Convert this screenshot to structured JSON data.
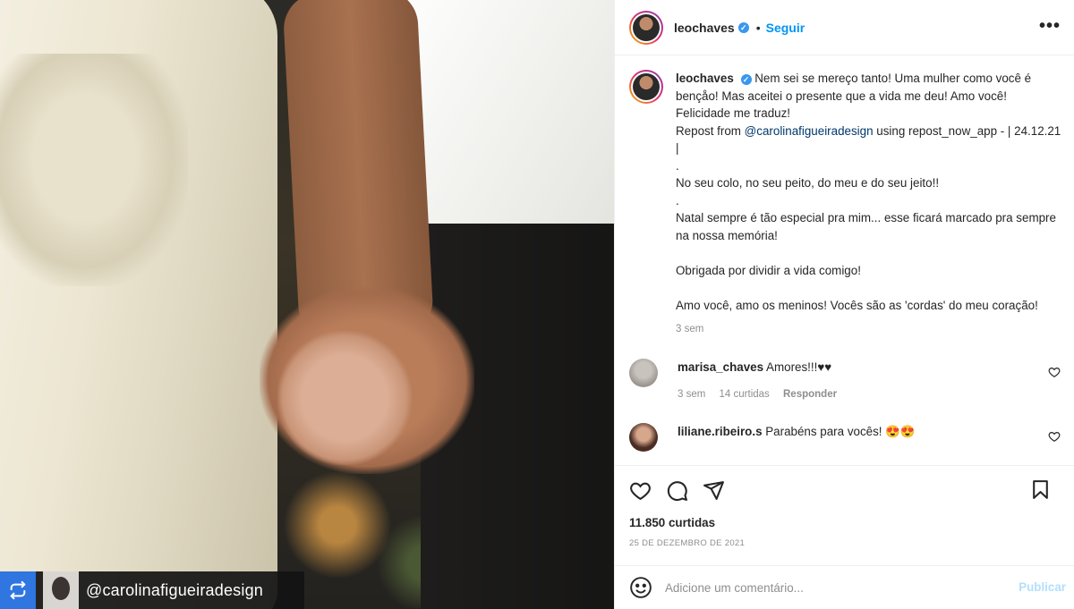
{
  "media": {
    "credit_handle": "@carolinafigueiradesign",
    "repost_icon": "repost-icon"
  },
  "header": {
    "username": "leochaves",
    "separator": "•",
    "follow_label": "Seguir",
    "more_icon": "more-options-icon",
    "more_glyph": "•••"
  },
  "caption": {
    "username": "leochaves",
    "lines": [
      "Nem sei se mereço tanto! Uma mulher como você é bençåo! Mas aceitei o presente que a vida me deu! Amo você! Felicidade me traduz!",
      "Repost from",
      "@carolinafigueiradesign",
      "using repost_now_app - | 24.12.21 |",
      ".",
      "No seu colo, no seu peito, do meu e do seu jeito!!",
      ".",
      "Natal sempre é tão especial pra mim... esse ficará marcado pra sempre na nossa memória!",
      "Obrigada por dividir a vida comigo!",
      "Amo você, amo os meninos! Vocês são as 'cordas' do meu coração!"
    ],
    "time": "3 sem"
  },
  "comments": [
    {
      "username": "marisa_chaves",
      "text": "Amores!!!♥♥",
      "time": "3 sem",
      "likes": "14 curtidas",
      "reply_label": "Responder"
    },
    {
      "username": "liliane.ribeiro.s",
      "text": "Parabéns para vocês! 😍😍"
    }
  ],
  "actions": {
    "like_icon": "heart-icon",
    "comment_icon": "comment-icon",
    "share_icon": "share-icon",
    "save_icon": "bookmark-icon",
    "likes_count": "11.850 curtidas",
    "date": "25 DE DEZEMBRO DE 2021"
  },
  "add_comment": {
    "placeholder": "Adicione um comentário...",
    "publish_label": "Publicar",
    "emoji_icon": "emoji-icon"
  },
  "colors": {
    "link_blue": "#0095f6",
    "publish_disabled": "#b2dffc",
    "muted": "#8e8e8e",
    "repost_blue": "#2f76e0"
  }
}
